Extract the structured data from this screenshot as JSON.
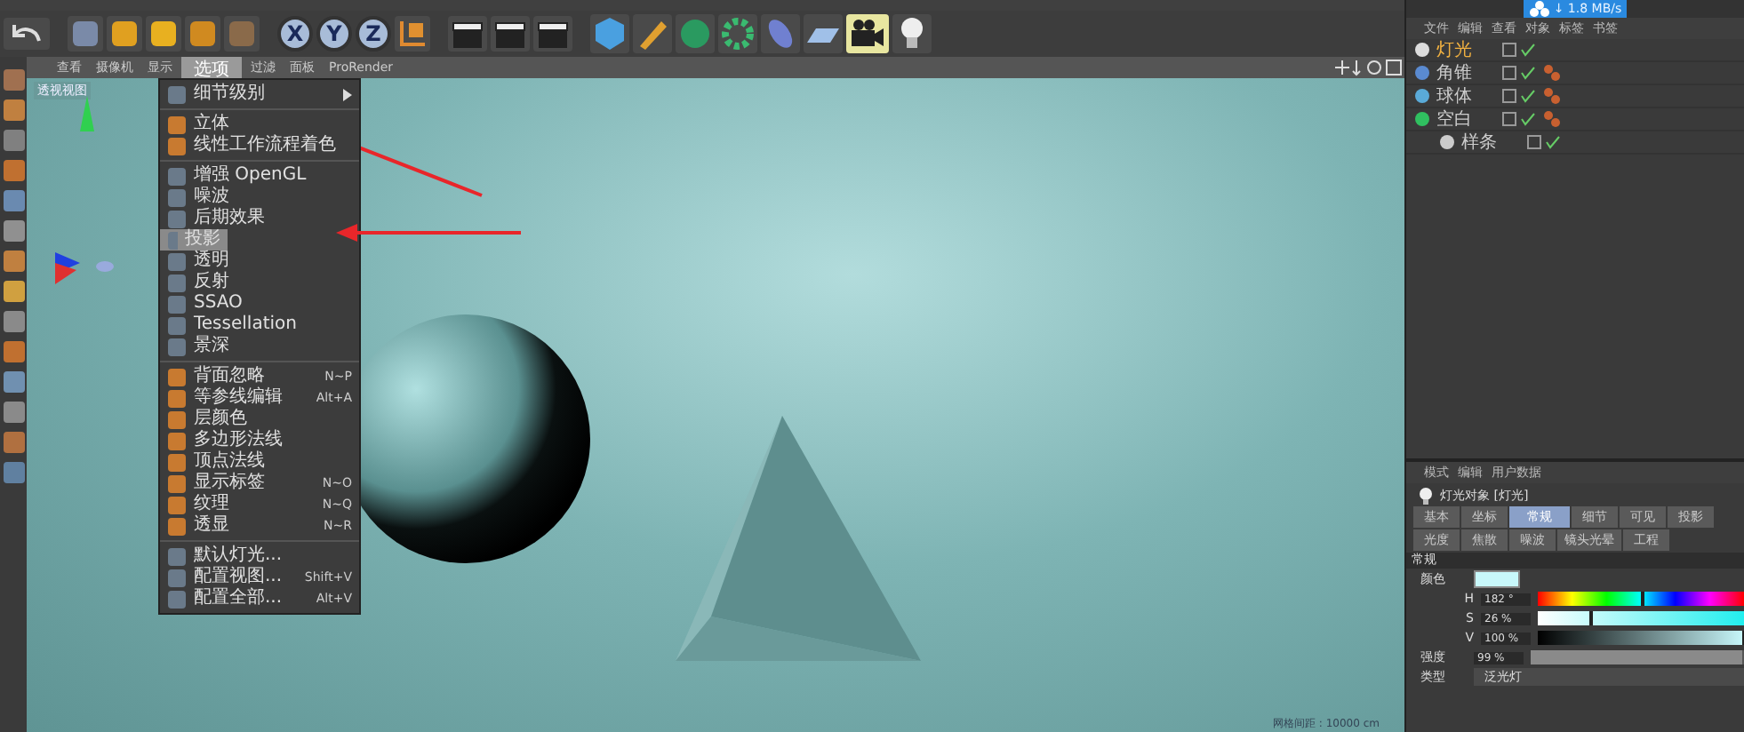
{
  "toolbar": {
    "axis_buttons": [
      "X",
      "Y",
      "Z"
    ]
  },
  "viewport": {
    "menu": [
      {
        "label": "查看",
        "selected": false
      },
      {
        "label": "摄像机",
        "selected": false
      },
      {
        "label": "显示",
        "selected": false
      },
      {
        "label": "选项",
        "selected": true
      },
      {
        "label": "过滤",
        "selected": false
      },
      {
        "label": "面板",
        "selected": false
      },
      {
        "label": "ProRender",
        "selected": false
      }
    ],
    "view_label": "透视视图",
    "grid_spacing": "网格间距 : 10000 cm"
  },
  "options_menu": {
    "groups": [
      [
        {
          "label": "细节级别",
          "submenu": true,
          "selected": false
        }
      ],
      [
        {
          "label": "立体",
          "submenu": false,
          "selected": false
        },
        {
          "label": "线性工作流程着色",
          "submenu": false,
          "selected": false
        }
      ],
      [
        {
          "label": "增强 OpenGL",
          "submenu": false,
          "selected": false
        },
        {
          "label": "噪波",
          "submenu": false,
          "selected": false
        },
        {
          "label": "后期效果",
          "submenu": false,
          "selected": false
        },
        {
          "label": "投影",
          "submenu": false,
          "selected": true
        },
        {
          "label": "透明",
          "submenu": false,
          "selected": false
        },
        {
          "label": "反射",
          "submenu": false,
          "selected": false
        },
        {
          "label": "SSAO",
          "submenu": false,
          "selected": false
        },
        {
          "label": "Tessellation",
          "submenu": false,
          "selected": false
        },
        {
          "label": "景深",
          "submenu": false,
          "selected": false
        }
      ],
      [
        {
          "label": "背面忽略",
          "shortcut": "N~P",
          "submenu": false,
          "selected": false
        },
        {
          "label": "等参线编辑",
          "shortcut": "Alt+A",
          "submenu": false,
          "selected": false
        },
        {
          "label": "层颜色",
          "submenu": false,
          "selected": false
        },
        {
          "label": "多边形法线",
          "submenu": false,
          "selected": false
        },
        {
          "label": "顶点法线",
          "submenu": false,
          "selected": false
        },
        {
          "label": "显示标签",
          "shortcut": "N~O",
          "submenu": false,
          "selected": false
        },
        {
          "label": "纹理",
          "shortcut": "N~Q",
          "submenu": false,
          "selected": false
        },
        {
          "label": "透显",
          "shortcut": "N~R",
          "submenu": false,
          "selected": false
        }
      ],
      [
        {
          "label": "默认灯光...",
          "submenu": false,
          "selected": false
        },
        {
          "label": "配置视图...",
          "shortcut": "Shift+V",
          "submenu": false,
          "selected": false
        },
        {
          "label": "配置全部...",
          "shortcut": "Alt+V",
          "submenu": false,
          "selected": false
        }
      ]
    ]
  },
  "download_badge": "↓ 1.8 MB/s",
  "object_manager": {
    "menu": [
      "文件",
      "编辑",
      "查看",
      "对象",
      "标签",
      "书签"
    ],
    "objects": [
      {
        "name": "灯光",
        "kind": "light",
        "selected": true,
        "tagged": false
      },
      {
        "name": "角锥",
        "kind": "pyramid",
        "selected": false,
        "tagged": true
      },
      {
        "name": "球体",
        "kind": "sphere",
        "selected": false,
        "tagged": true
      },
      {
        "name": "空白",
        "kind": "null",
        "selected": false,
        "tagged": true,
        "children": [
          {
            "name": "样条",
            "kind": "spline",
            "selected": false,
            "tagged": false
          }
        ]
      }
    ]
  },
  "attribute_manager": {
    "menu": [
      "模式",
      "编辑",
      "用户数据"
    ],
    "object_title": "灯光对象 [灯光]",
    "tabs": [
      {
        "label": "基本",
        "selected": false
      },
      {
        "label": "坐标",
        "selected": false
      },
      {
        "label": "常规",
        "selected": true
      },
      {
        "label": "细节",
        "selected": false
      },
      {
        "label": "可见",
        "selected": false
      },
      {
        "label": "投影",
        "selected": false
      },
      {
        "label": "光度",
        "selected": false
      },
      {
        "label": "焦散",
        "selected": false
      },
      {
        "label": "噪波",
        "selected": false
      },
      {
        "label": "镜头光晕",
        "selected": false
      },
      {
        "label": "工程",
        "selected": false
      }
    ],
    "section": "常规",
    "color_label": "颜色",
    "color": "#c8f8fb",
    "hsv": [
      {
        "label": "H",
        "value": "182 °",
        "level": 0.505
      },
      {
        "label": "S",
        "value": "26 %",
        "level": 0.26
      },
      {
        "label": "V",
        "value": "100 %",
        "level": 1
      }
    ],
    "intensity": {
      "label": "强度",
      "value": "99 %",
      "level": 0.99
    },
    "type": {
      "label": "类型",
      "value": "泛光灯"
    }
  }
}
